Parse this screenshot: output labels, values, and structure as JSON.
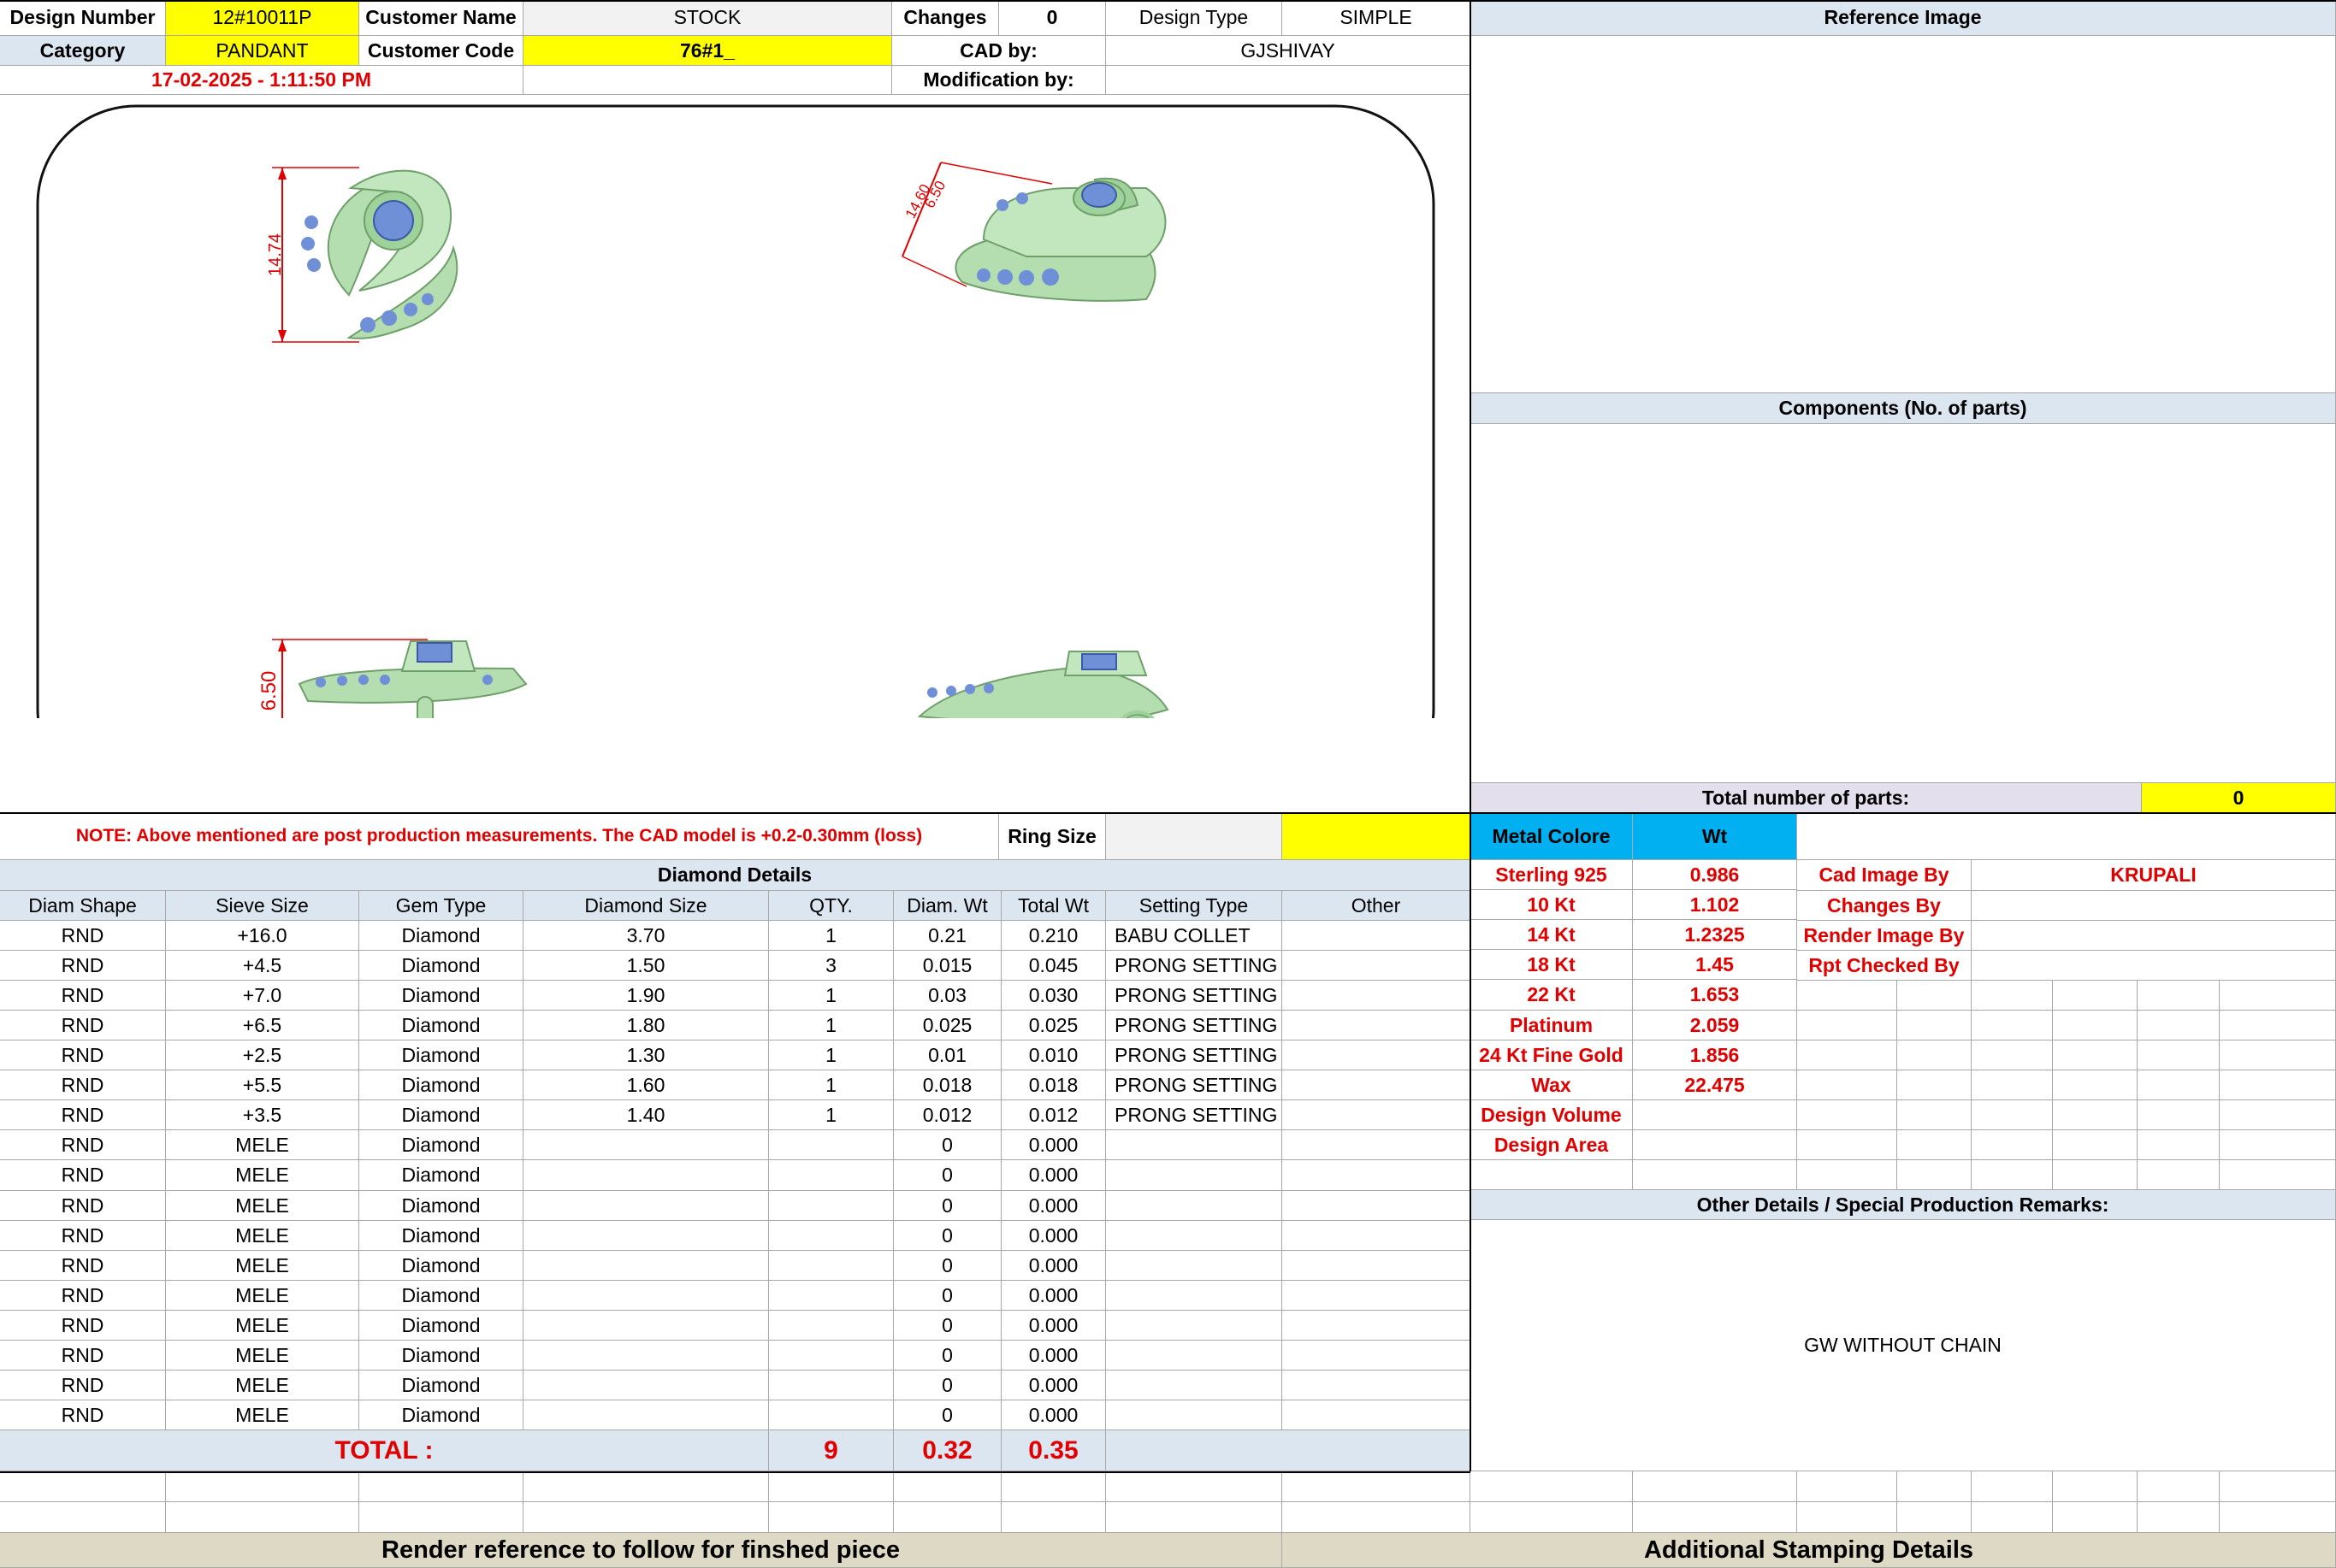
{
  "header": {
    "design_number_label": "Design Number",
    "design_number": "12#10011P",
    "customer_name_label": "Customer Name",
    "customer_name": "STOCK",
    "changes_label": "Changes",
    "changes": "0",
    "design_type_label": "Design Type",
    "design_type": "SIMPLE",
    "category_label": "Category",
    "category": "PANDANT",
    "customer_code_label": "Customer Code",
    "customer_code": "76#1_",
    "cad_by_label": "CAD by:",
    "cad_by": "GJSHIVAY",
    "timestamp": "17-02-2025 - 1:11:50 PM",
    "modification_by_label": "Modification by:"
  },
  "reference_image_label": "Reference Image",
  "components_label": "Components (No. of parts)",
  "total_parts_label": "Total number of parts:",
  "total_parts": "0",
  "drawing": {
    "dim_front_height": "14.74",
    "dim_side_height": "6.50",
    "dim_perspective_a": "14.60",
    "dim_perspective_b": "6.50"
  },
  "note": "NOTE: Above mentioned are post production measurements. The CAD model is +0.2-0.30mm (loss)",
  "ring_size_label": "Ring Size",
  "metal": {
    "header_label": "Metal Colore",
    "wt_label": "Wt",
    "rows": [
      {
        "name": "Sterling 925",
        "wt": "0.986"
      },
      {
        "name": "10 Kt",
        "wt": "1.102"
      },
      {
        "name": "14 Kt",
        "wt": "1.2325"
      },
      {
        "name": "18 Kt",
        "wt": "1.45"
      },
      {
        "name": "22 Kt",
        "wt": "1.653"
      },
      {
        "name": "Platinum",
        "wt": "2.059"
      },
      {
        "name": "24 Kt Fine Gold",
        "wt": "1.856"
      },
      {
        "name": "Wax",
        "wt": "22.475"
      },
      {
        "name": "Design Volume",
        "wt": ""
      },
      {
        "name": "Design Area",
        "wt": ""
      }
    ]
  },
  "staff": {
    "cad_image_by_label": "Cad Image By",
    "cad_image_by": "KRUPALI",
    "changes_by_label": "Changes By",
    "render_image_by_label": "Render Image By",
    "rpt_checked_by_label": "Rpt Checked By"
  },
  "other_details_label": "Other Details / Special Production Remarks:",
  "remarks": "GW WITHOUT CHAIN",
  "diamond": {
    "title": "Diamond Details",
    "columns": [
      "Diam Shape",
      "Sieve Size",
      "Gem Type",
      "Diamond Size",
      "QTY.",
      "Diam. Wt",
      "Total Wt",
      "Setting Type",
      "Other"
    ],
    "rows": [
      [
        "RND",
        "+16.0",
        "Diamond",
        "3.70",
        "1",
        "0.21",
        "0.210",
        "BABU COLLET",
        ""
      ],
      [
        "RND",
        "+4.5",
        "Diamond",
        "1.50",
        "3",
        "0.015",
        "0.045",
        "PRONG SETTING",
        ""
      ],
      [
        "RND",
        "+7.0",
        "Diamond",
        "1.90",
        "1",
        "0.03",
        "0.030",
        "PRONG SETTING",
        ""
      ],
      [
        "RND",
        "+6.5",
        "Diamond",
        "1.80",
        "1",
        "0.025",
        "0.025",
        "PRONG SETTING",
        ""
      ],
      [
        "RND",
        "+2.5",
        "Diamond",
        "1.30",
        "1",
        "0.01",
        "0.010",
        "PRONG SETTING",
        ""
      ],
      [
        "RND",
        "+5.5",
        "Diamond",
        "1.60",
        "1",
        "0.018",
        "0.018",
        "PRONG SETTING",
        ""
      ],
      [
        "RND",
        "+3.5",
        "Diamond",
        "1.40",
        "1",
        "0.012",
        "0.012",
        "PRONG SETTING",
        ""
      ],
      [
        "RND",
        "MELE",
        "Diamond",
        "",
        "",
        "0",
        "0.000",
        "",
        ""
      ],
      [
        "RND",
        "MELE",
        "Diamond",
        "",
        "",
        "0",
        "0.000",
        "",
        ""
      ],
      [
        "RND",
        "MELE",
        "Diamond",
        "",
        "",
        "0",
        "0.000",
        "",
        ""
      ],
      [
        "RND",
        "MELE",
        "Diamond",
        "",
        "",
        "0",
        "0.000",
        "",
        ""
      ],
      [
        "RND",
        "MELE",
        "Diamond",
        "",
        "",
        "0",
        "0.000",
        "",
        ""
      ],
      [
        "RND",
        "MELE",
        "Diamond",
        "",
        "",
        "0",
        "0.000",
        "",
        ""
      ],
      [
        "RND",
        "MELE",
        "Diamond",
        "",
        "",
        "0",
        "0.000",
        "",
        ""
      ],
      [
        "RND",
        "MELE",
        "Diamond",
        "",
        "",
        "0",
        "0.000",
        "",
        ""
      ],
      [
        "RND",
        "MELE",
        "Diamond",
        "",
        "",
        "0",
        "0.000",
        "",
        ""
      ],
      [
        "RND",
        "MELE",
        "Diamond",
        "",
        "",
        "0",
        "0.000",
        "",
        ""
      ]
    ],
    "total_label": "TOTAL :",
    "total_qty": "9",
    "total_diam_wt": "0.32",
    "total_wt": "0.35"
  },
  "footer": {
    "render_reference": "Render reference to follow for finshed piece",
    "additional_stamping": "Additional Stamping Details"
  },
  "colors": {
    "header_blue": "#dce6f1",
    "yellow": "#ffff00",
    "metal_cyan": "#00b0f0",
    "footer_tan": "#ddd9c4",
    "accent_red": "#e00000",
    "metal_green": "#b4ddb0",
    "gem_blue": "#6f8fd6"
  }
}
